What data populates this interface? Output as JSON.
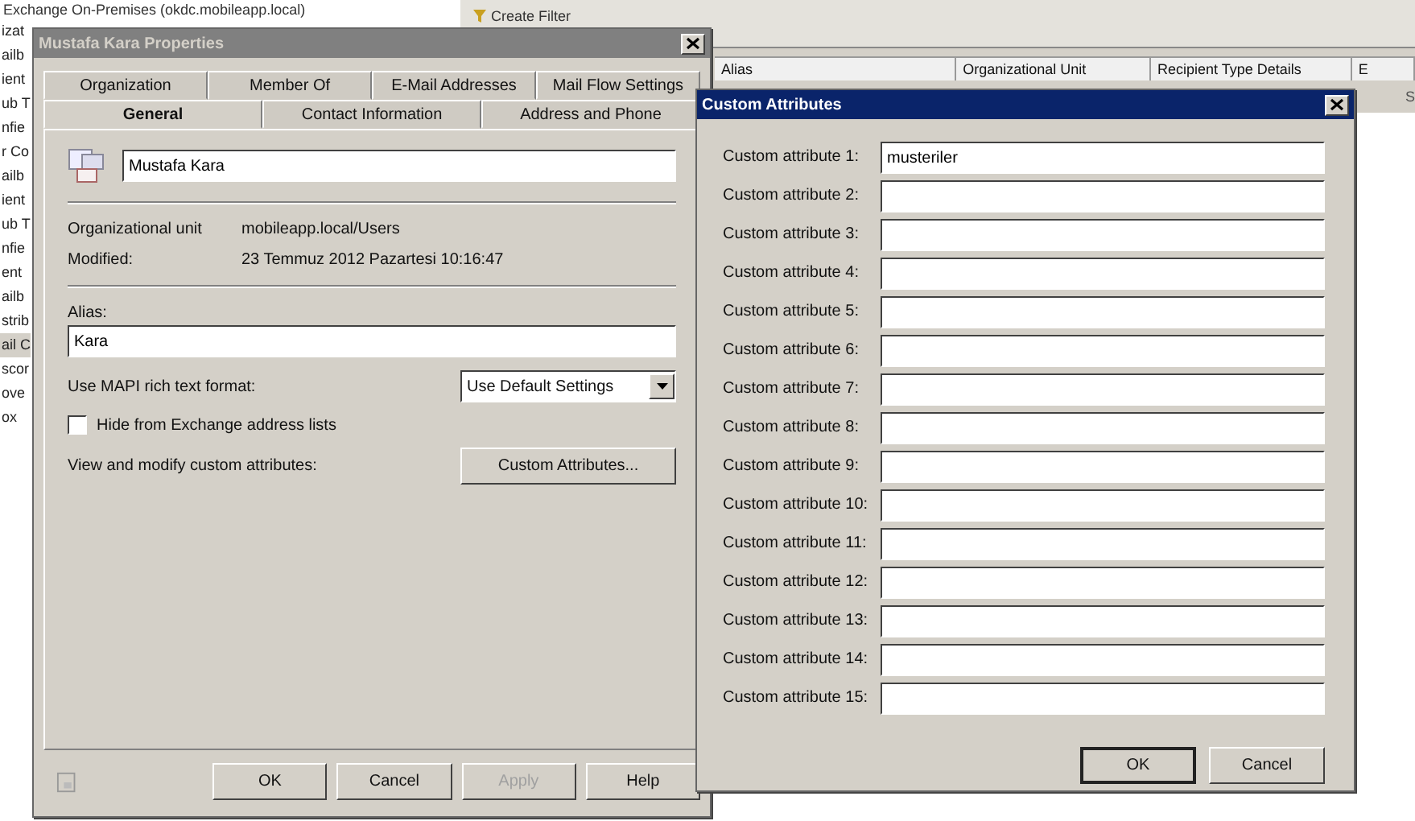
{
  "background": {
    "tree_title": "Exchange On-Premises (okdc.mobileapp.local)",
    "tree_items": [
      {
        "label": "izat",
        "selected": false
      },
      {
        "label": "ailb",
        "selected": false
      },
      {
        "label": "ient",
        "selected": false
      },
      {
        "label": "ub T",
        "selected": false
      },
      {
        "label": "nfie",
        "selected": false
      },
      {
        "label": "r Co",
        "selected": false
      },
      {
        "label": "ailb",
        "selected": false
      },
      {
        "label": "ient",
        "selected": false
      },
      {
        "label": "ub T",
        "selected": false
      },
      {
        "label": "nfie",
        "selected": false
      },
      {
        "label": "ent",
        "selected": false
      },
      {
        "label": "ailb",
        "selected": false
      },
      {
        "label": "strib",
        "selected": false
      },
      {
        "label": "ail C",
        "selected": true
      },
      {
        "label": "scor",
        "selected": false
      },
      {
        "label": "ove",
        "selected": false
      },
      {
        "label": "ox",
        "selected": false
      }
    ],
    "toolbar_button": "Create Filter",
    "columns": [
      "Alias",
      "Organizational Unit",
      "Recipient Type Details",
      "E"
    ],
    "cell_fragment": "S"
  },
  "properties_dialog": {
    "title": "Mustafa Kara Properties",
    "active": false,
    "tab_rows": [
      [
        {
          "label": "Organization",
          "selected": false
        },
        {
          "label": "Member Of",
          "selected": false
        },
        {
          "label": "E-Mail Addresses",
          "selected": false
        },
        {
          "label": "Mail Flow Settings",
          "selected": false
        }
      ],
      [
        {
          "label": "General",
          "selected": true
        },
        {
          "label": "Contact Information",
          "selected": false
        },
        {
          "label": "Address and Phone",
          "selected": false
        }
      ]
    ],
    "display_name": "Mustafa Kara",
    "info": [
      {
        "label": "Organizational unit",
        "value": "mobileapp.local/Users"
      },
      {
        "label": "Modified:",
        "value": "23 Temmuz 2012 Pazartesi 10:16:47"
      }
    ],
    "alias": {
      "label": "Alias:",
      "value": "Kara"
    },
    "mapi": {
      "label": "Use MAPI rich text format:",
      "value": "Use Default Settings"
    },
    "hide_checkbox": {
      "label": "Hide from Exchange address lists",
      "checked": false
    },
    "custom": {
      "label": "View and modify custom attributes:",
      "button": "Custom Attributes..."
    },
    "buttons": [
      {
        "label": "OK",
        "disabled": false
      },
      {
        "label": "Cancel",
        "disabled": false
      },
      {
        "label": "Apply",
        "disabled": true
      },
      {
        "label": "Help",
        "disabled": false
      }
    ]
  },
  "custom_attributes_dialog": {
    "title": "Custom Attributes",
    "active": true,
    "attributes": [
      {
        "label": "Custom attribute 1:",
        "value": "musteriler"
      },
      {
        "label": "Custom attribute 2:"
      },
      {
        "label": "Custom attribute 3:"
      },
      {
        "label": "Custom attribute 4:"
      },
      {
        "label": "Custom attribute 5:"
      },
      {
        "label": "Custom attribute 6:"
      },
      {
        "label": "Custom attribute 7:"
      },
      {
        "label": "Custom attribute 8:"
      },
      {
        "label": "Custom attribute 9:"
      },
      {
        "label": "Custom attribute 10:"
      },
      {
        "label": "Custom attribute 11:"
      },
      {
        "label": "Custom attribute 12:"
      },
      {
        "label": "Custom attribute 13:"
      },
      {
        "label": "Custom attribute 14:"
      },
      {
        "label": "Custom attribute 15:"
      }
    ],
    "buttons": [
      {
        "label": "OK",
        "default": true
      },
      {
        "label": "Cancel",
        "default": false
      }
    ]
  }
}
